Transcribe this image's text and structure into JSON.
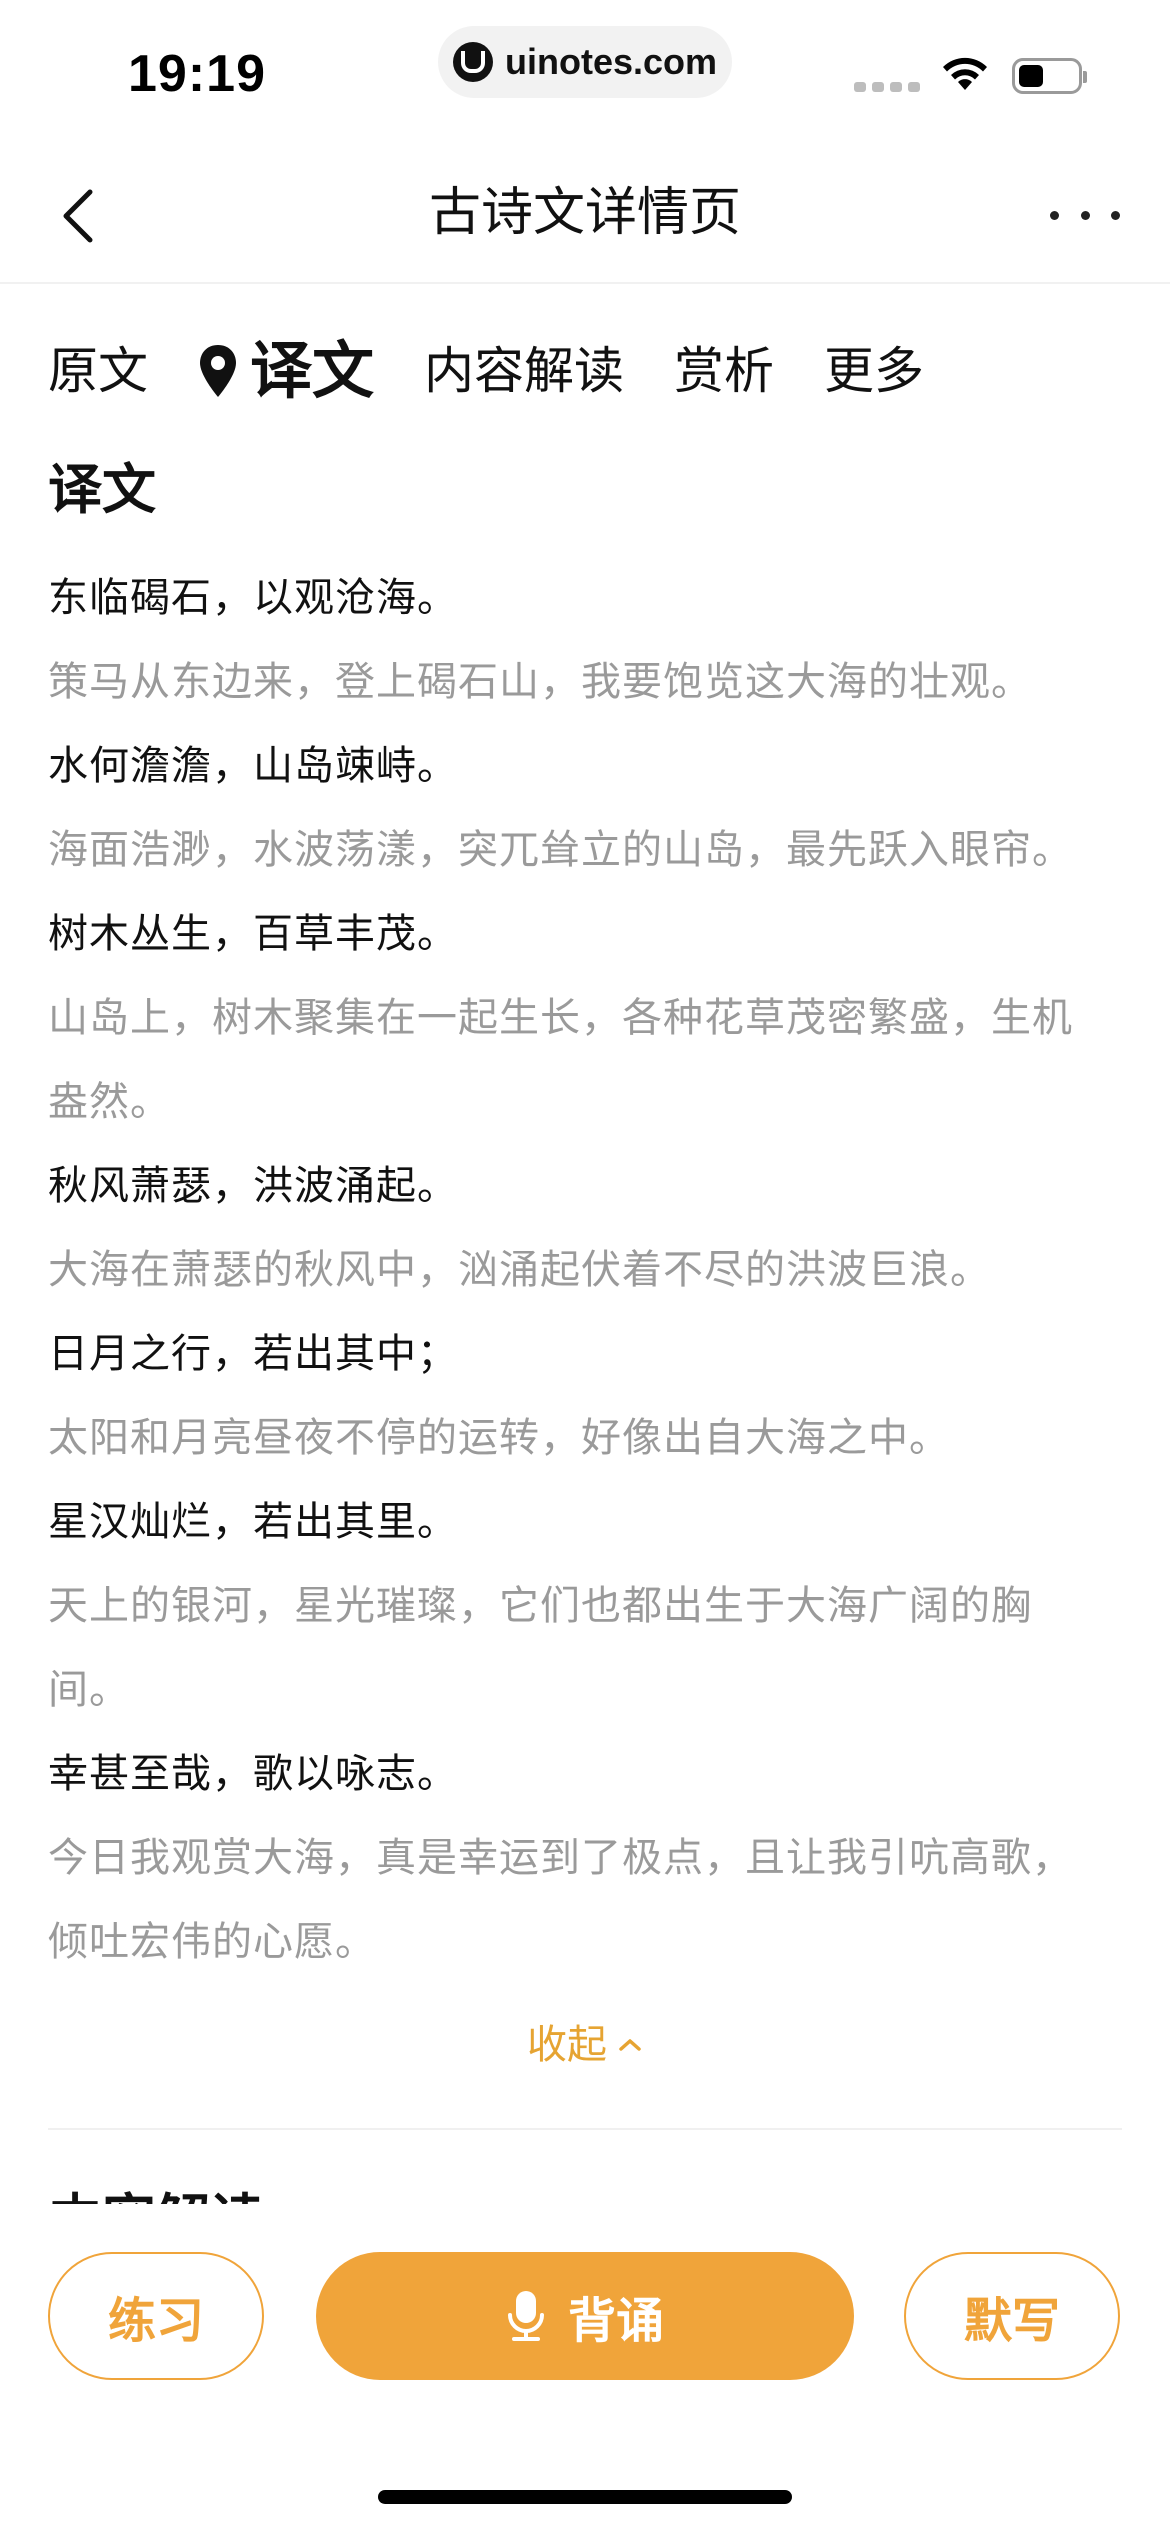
{
  "status_bar": {
    "time": "19:19",
    "url": "uinotes.com"
  },
  "nav": {
    "title": "古诗文详情页"
  },
  "tabs": [
    {
      "label": "原文",
      "active": false
    },
    {
      "label": "译文",
      "active": true
    },
    {
      "label": "内容解读",
      "active": false
    },
    {
      "label": "赏析",
      "active": false
    },
    {
      "label": "更多",
      "active": false
    }
  ],
  "section": {
    "title": "译文",
    "lines": [
      {
        "type": "orig",
        "text": "东临碣石，以观沧海。"
      },
      {
        "type": "trans",
        "text": "策马从东边来，登上碣石山，我要饱览这大海的壮观。"
      },
      {
        "type": "orig",
        "text": "水何澹澹，山岛竦峙。"
      },
      {
        "type": "trans",
        "text": "海面浩渺，水波荡漾，突兀耸立的山岛，最先跃入眼帘。"
      },
      {
        "type": "orig",
        "text": "树木丛生，百草丰茂。"
      },
      {
        "type": "trans",
        "text": "山岛上，树木聚集在一起生长，各种花草茂密繁盛，生机"
      },
      {
        "type": "trans",
        "text": "盎然。"
      },
      {
        "type": "orig",
        "text": "秋风萧瑟，洪波涌起。"
      },
      {
        "type": "trans",
        "text": "大海在萧瑟的秋风中，汹涌起伏着不尽的洪波巨浪。"
      },
      {
        "type": "orig",
        "text": "日月之行，若出其中；"
      },
      {
        "type": "trans",
        "text": "太阳和月亮昼夜不停的运转，好像出自大海之中。"
      },
      {
        "type": "orig",
        "text": "星汉灿烂，若出其里。"
      },
      {
        "type": "trans",
        "text": "天上的银河，星光璀璨，它们也都出生于大海广阔的胸"
      },
      {
        "type": "trans",
        "text": "间。"
      },
      {
        "type": "orig",
        "text": "幸甚至哉，歌以咏志。"
      },
      {
        "type": "trans",
        "text": "今日我观赏大海，真是幸运到了极点，且让我引吭高歌，"
      },
      {
        "type": "trans",
        "text": "倾吐宏伟的心愿。"
      }
    ],
    "collapse_label": "收起"
  },
  "next_section_title": "内容解读",
  "bottom_bar": {
    "practice_label": "练习",
    "recite_label": "背诵",
    "dictate_label": "默写"
  },
  "colors": {
    "accent": "#f0a43a",
    "collapse_text": "#e6a432",
    "translation_text": "#9a9a9a"
  }
}
